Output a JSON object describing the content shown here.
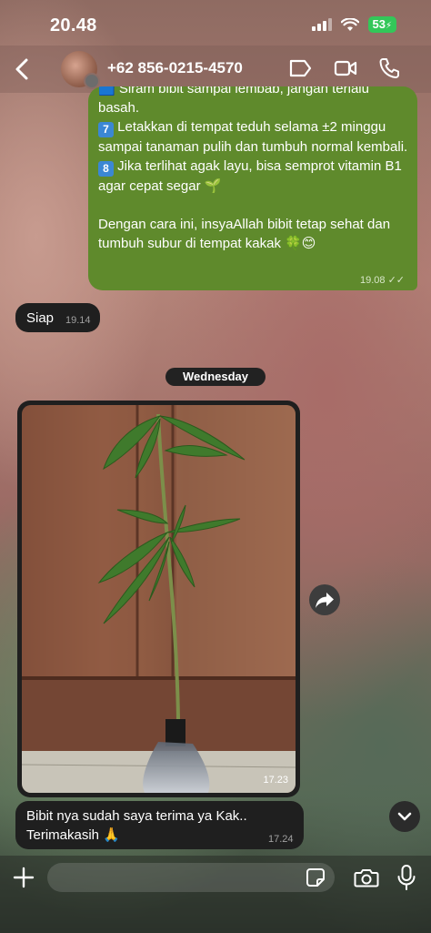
{
  "status_bar": {
    "time": "20.48",
    "battery": "53"
  },
  "header": {
    "contact_name": "+62 856-0215-4570"
  },
  "messages": {
    "outgoing_tip": {
      "partial_line": "🟦 Siram bibit sampai lembab, jangan terlalu",
      "line_basah": "basah.",
      "item7_num": "7",
      "item7_text": "Letakkan di tempat teduh selama ±2 minggu sampai tanaman pulih dan tumbuh normal kembali.",
      "item8_num": "8",
      "item8_text": "Jika terlihat agak layu, bisa semprot vitamin B1 agar cepat segar 🌱",
      "closing": "Dengan cara ini, insyaAllah bibit tetap sehat dan tumbuh subur di tempat kakak 🍀😊",
      "time": "19.08"
    },
    "siap": {
      "text": "Siap",
      "time": "19.14"
    },
    "date_separator": "Wednesday",
    "photo": {
      "time": "17.23"
    },
    "final": {
      "text": "Bibit nya sudah saya terima ya Kak.. Terimakasih 🙏",
      "time": "17.24"
    }
  },
  "input": {
    "placeholder": ""
  },
  "colors": {
    "outgoing_bubble": "#5f8a2c",
    "incoming_bubble": "#1f1f1f",
    "keycap": "#3b87d4"
  },
  "icons": [
    "back-icon",
    "avatar",
    "video-call-icon",
    "camera-call-icon",
    "phone-icon",
    "forward-icon",
    "chevron-down-icon",
    "plus-icon",
    "sticker-icon",
    "camera-icon",
    "mic-icon",
    "read-receipt-icon"
  ]
}
